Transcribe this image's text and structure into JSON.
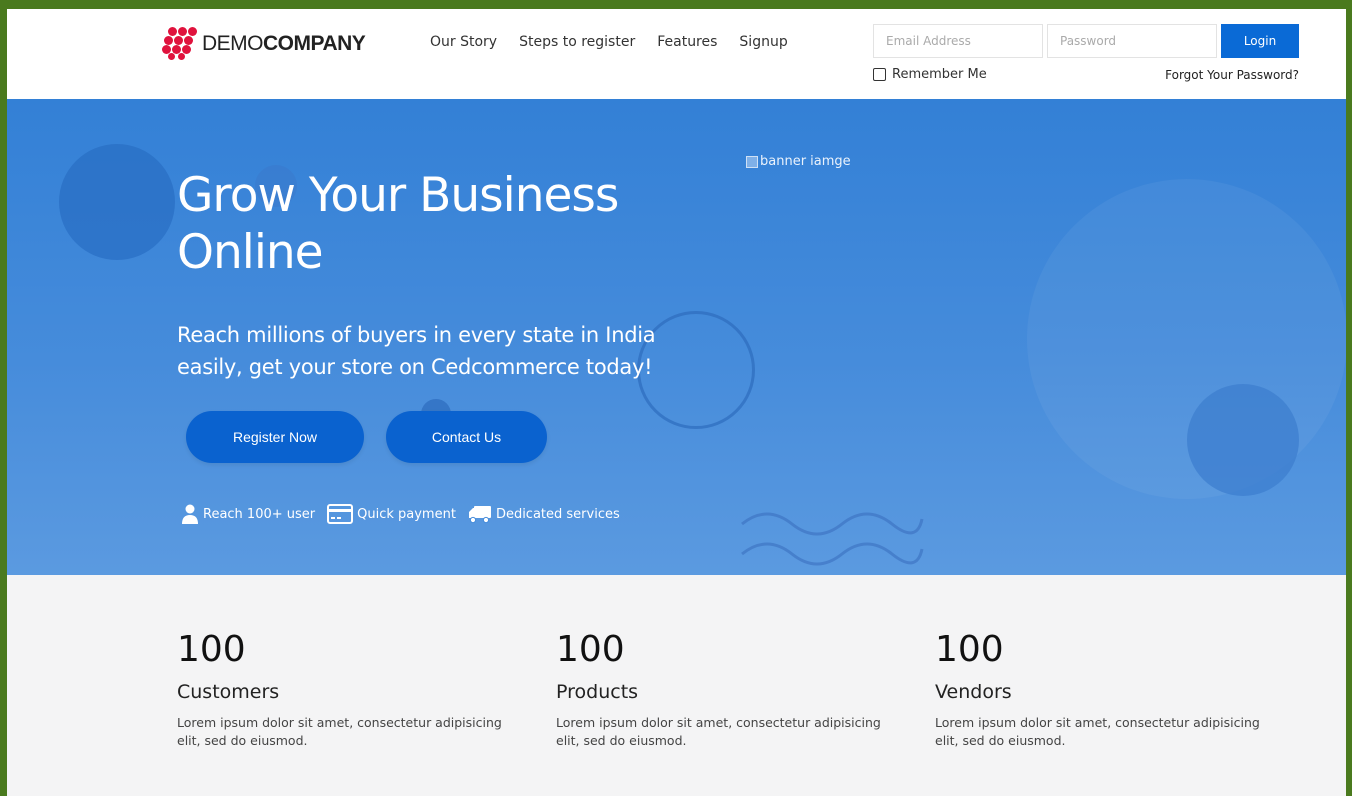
{
  "brand": {
    "name_light": "DEMO",
    "name_bold": "COMPANY",
    "logo_color": "#e0123d"
  },
  "nav": {
    "items": [
      {
        "label": "Our Story"
      },
      {
        "label": "Steps to register"
      },
      {
        "label": "Features"
      },
      {
        "label": "Signup"
      }
    ]
  },
  "login": {
    "email_placeholder": "Email Address",
    "password_placeholder": "Password",
    "button_label": "Login",
    "remember_label": "Remember Me",
    "forgot_label": "Forgot Your Password?",
    "accent": "#0a6ad6"
  },
  "hero": {
    "image_alt": "banner iamge",
    "title": "Grow Your Business Online",
    "subtitle": "Reach millions of buyers in every state in India easily, get your store on Cedcommerce today!",
    "register_label": "Register Now",
    "contact_label": "Contact Us",
    "features": [
      {
        "icon": "user-icon",
        "label": "Reach 100+ user"
      },
      {
        "icon": "credit-card-icon",
        "label": "Quick payment"
      },
      {
        "icon": "truck-icon",
        "label": "Dedicated services"
      }
    ],
    "background": "#3a85d8"
  },
  "stats": [
    {
      "number": "100",
      "label": "Customers",
      "desc": "Lorem ipsum dolor sit amet, consectetur adipisicing elit, sed do eiusmod."
    },
    {
      "number": "100",
      "label": "Products",
      "desc": "Lorem ipsum dolor sit amet, consectetur adipisicing elit, sed do eiusmod."
    },
    {
      "number": "100",
      "label": "Vendors",
      "desc": "Lorem ipsum dolor sit amet, consectetur adipisicing elit, sed do eiusmod."
    }
  ]
}
